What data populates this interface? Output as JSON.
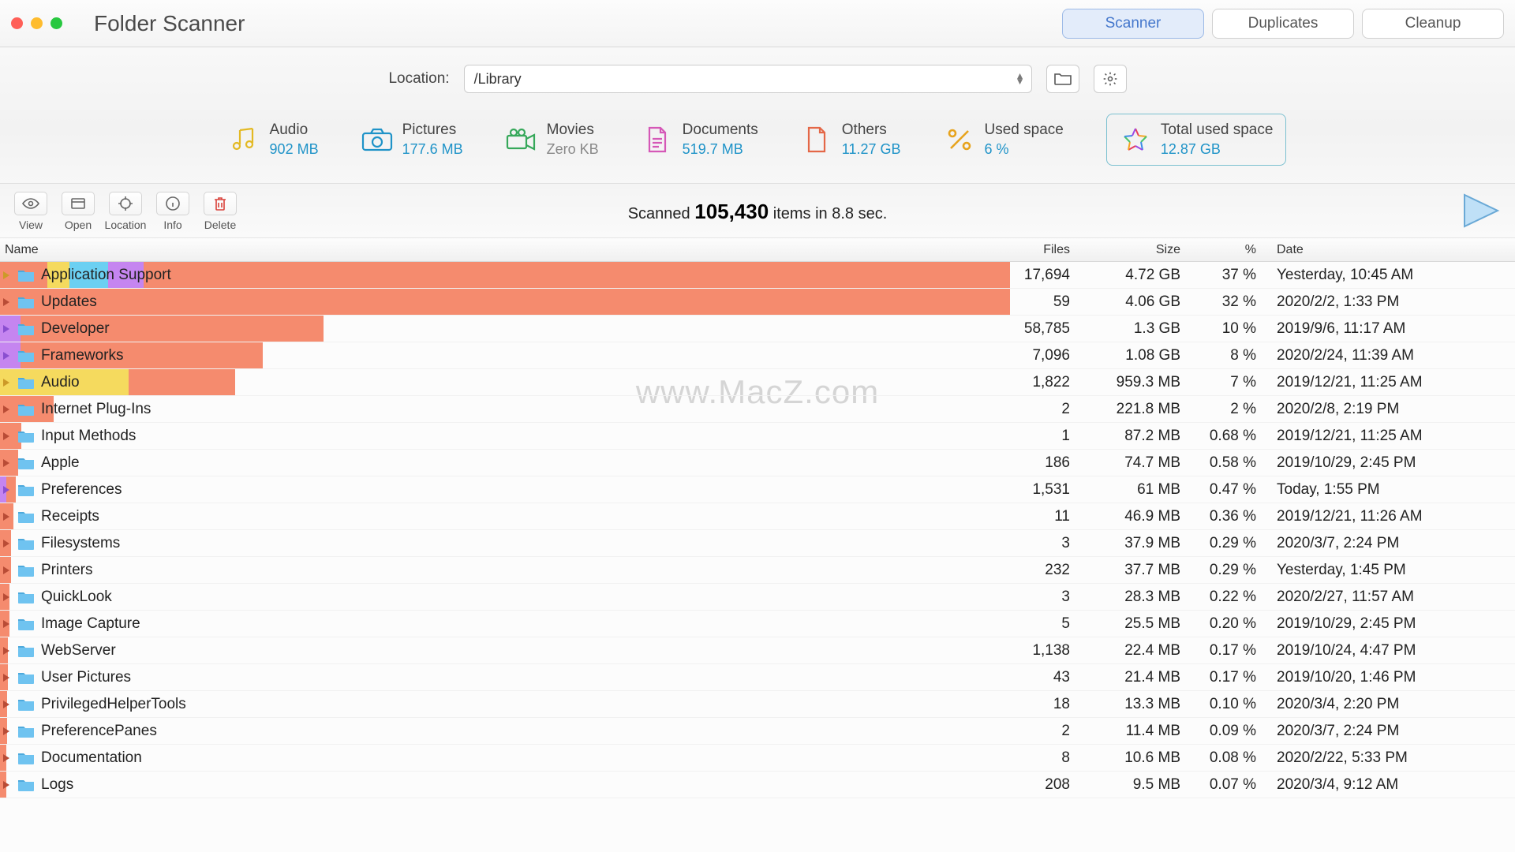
{
  "app_title": "Folder Scanner",
  "tabs": {
    "scanner": "Scanner",
    "duplicates": "Duplicates",
    "cleanup": "Cleanup"
  },
  "location": {
    "label": "Location:",
    "value": "/Library"
  },
  "stats": {
    "audio": {
      "label": "Audio",
      "value": "902 MB",
      "color": "#e3b923"
    },
    "pictures": {
      "label": "Pictures",
      "value": "177.6 MB",
      "color": "#1f93c8"
    },
    "movies": {
      "label": "Movies",
      "value": "Zero KB",
      "color": "#999",
      "grey": true
    },
    "documents": {
      "label": "Documents",
      "value": "519.7 MB",
      "color": "#d558b7"
    },
    "others": {
      "label": "Others",
      "value": "11.27 GB",
      "color": "#e46747"
    },
    "used": {
      "label": "Used space",
      "value": "6 %",
      "color": "#e7a31d"
    },
    "total": {
      "label": "Total used space",
      "value": "12.87 GB",
      "color": "#1f93c8"
    }
  },
  "toolbar": {
    "view": "View",
    "open": "Open",
    "location": "Location",
    "info": "Info",
    "delete": "Delete"
  },
  "scan_status": {
    "prefix": "Scanned ",
    "count": "105,430",
    "suffix": " items in 8.8 sec."
  },
  "columns": {
    "name": "Name",
    "files": "Files",
    "size": "Size",
    "pct": "%",
    "date": "Date"
  },
  "rows": [
    {
      "name": "Application Support",
      "files": "17,694",
      "size": "4.72 GB",
      "pct": "37 %",
      "date": "Yesterday, 10:45 AM",
      "bar": [
        [
          "orange",
          4.7
        ],
        [
          "yellow",
          2.2
        ],
        [
          "blue",
          3.8
        ],
        [
          "purple",
          3.5
        ],
        [
          "orange",
          85.8
        ]
      ],
      "tri": "#cc9a28"
    },
    {
      "name": "Updates",
      "files": "59",
      "size": "4.06 GB",
      "pct": "32 %",
      "date": "2020/2/2, 1:33 PM",
      "bar": [
        [
          "orange",
          100
        ]
      ],
      "tri": "#b94c36"
    },
    {
      "name": "Developer",
      "files": "58,785",
      "size": "1.3 GB",
      "pct": "10 %",
      "date": "2019/9/6, 11:17 AM",
      "bar": [
        [
          "purple",
          2
        ],
        [
          "orange",
          30
        ]
      ],
      "tri": "#8a4ed0"
    },
    {
      "name": "Frameworks",
      "files": "7,096",
      "size": "1.08 GB",
      "pct": "8 %",
      "date": "2020/2/24, 11:39 AM",
      "bar": [
        [
          "purple",
          2
        ],
        [
          "orange",
          24
        ]
      ],
      "tri": "#8a4ed0"
    },
    {
      "name": "Audio",
      "files": "1,822",
      "size": "959.3 MB",
      "pct": "7 %",
      "date": "2019/12/21, 11:25 AM",
      "bar": [
        [
          "yellow",
          12.7
        ],
        [
          "orange",
          10.6
        ]
      ],
      "tri": "#cc9a28"
    },
    {
      "name": "Internet Plug-Ins",
      "files": "2",
      "size": "221.8 MB",
      "pct": "2 %",
      "date": "2020/2/8, 2:19 PM",
      "bar": [
        [
          "orange",
          5.3
        ]
      ],
      "tri": "#b94c36"
    },
    {
      "name": "Input Methods",
      "files": "1",
      "size": "87.2 MB",
      "pct": "0.68 %",
      "date": "2019/12/21, 11:25 AM",
      "bar": [
        [
          "orange",
          2.1
        ]
      ],
      "tri": "#b94c36"
    },
    {
      "name": "Apple",
      "files": "186",
      "size": "74.7 MB",
      "pct": "0.58 %",
      "date": "2019/10/29, 2:45 PM",
      "bar": [
        [
          "orange",
          1.8
        ]
      ],
      "tri": "#b94c36"
    },
    {
      "name": "Preferences",
      "files": "1,531",
      "size": "61 MB",
      "pct": "0.47 %",
      "date": "Today, 1:55 PM",
      "bar": [
        [
          "purple",
          0.6
        ],
        [
          "orange",
          1.0
        ]
      ],
      "tri": "#8a4ed0"
    },
    {
      "name": "Receipts",
      "files": "11",
      "size": "46.9 MB",
      "pct": "0.36 %",
      "date": "2019/12/21, 11:26 AM",
      "bar": [
        [
          "orange",
          1.3
        ]
      ],
      "tri": "#b94c36"
    },
    {
      "name": "Filesystems",
      "files": "3",
      "size": "37.9 MB",
      "pct": "0.29 %",
      "date": "2020/3/7, 2:24 PM",
      "bar": [
        [
          "orange",
          1.1
        ]
      ],
      "tri": "#b94c36"
    },
    {
      "name": "Printers",
      "files": "232",
      "size": "37.7 MB",
      "pct": "0.29 %",
      "date": "Yesterday, 1:45 PM",
      "bar": [
        [
          "orange",
          1.1
        ]
      ],
      "tri": "#b94c36"
    },
    {
      "name": "QuickLook",
      "files": "3",
      "size": "28.3 MB",
      "pct": "0.22 %",
      "date": "2020/2/27, 11:57 AM",
      "bar": [
        [
          "orange",
          0.9
        ]
      ],
      "tri": "#b94c36"
    },
    {
      "name": "Image Capture",
      "files": "5",
      "size": "25.5 MB",
      "pct": "0.20 %",
      "date": "2019/10/29, 2:45 PM",
      "bar": [
        [
          "orange",
          0.9
        ]
      ],
      "tri": "#b94c36"
    },
    {
      "name": "WebServer",
      "files": "1,138",
      "size": "22.4 MB",
      "pct": "0.17 %",
      "date": "2019/10/24, 4:47 PM",
      "bar": [
        [
          "orange",
          0.8
        ]
      ],
      "tri": "#b94c36"
    },
    {
      "name": "User Pictures",
      "files": "43",
      "size": "21.4 MB",
      "pct": "0.17 %",
      "date": "2019/10/20, 1:46 PM",
      "bar": [
        [
          "orange",
          0.8
        ]
      ],
      "tri": "#b94c36"
    },
    {
      "name": "PrivilegedHelperTools",
      "files": "18",
      "size": "13.3 MB",
      "pct": "0.10 %",
      "date": "2020/3/4, 2:20 PM",
      "bar": [
        [
          "orange",
          0.7
        ]
      ],
      "tri": "#b94c36"
    },
    {
      "name": "PreferencePanes",
      "files": "2",
      "size": "11.4 MB",
      "pct": "0.09 %",
      "date": "2020/3/7, 2:24 PM",
      "bar": [
        [
          "orange",
          0.7
        ]
      ],
      "tri": "#b94c36"
    },
    {
      "name": "Documentation",
      "files": "8",
      "size": "10.6 MB",
      "pct": "0.08 %",
      "date": "2020/2/22, 5:33 PM",
      "bar": [
        [
          "orange",
          0.6
        ]
      ],
      "tri": "#b94c36"
    },
    {
      "name": "Logs",
      "files": "208",
      "size": "9.5 MB",
      "pct": "0.07 %",
      "date": "2020/3/4, 9:12 AM",
      "bar": [
        [
          "orange",
          0.6
        ]
      ],
      "tri": "#b94c36"
    }
  ],
  "watermark": "www.MacZ.com"
}
